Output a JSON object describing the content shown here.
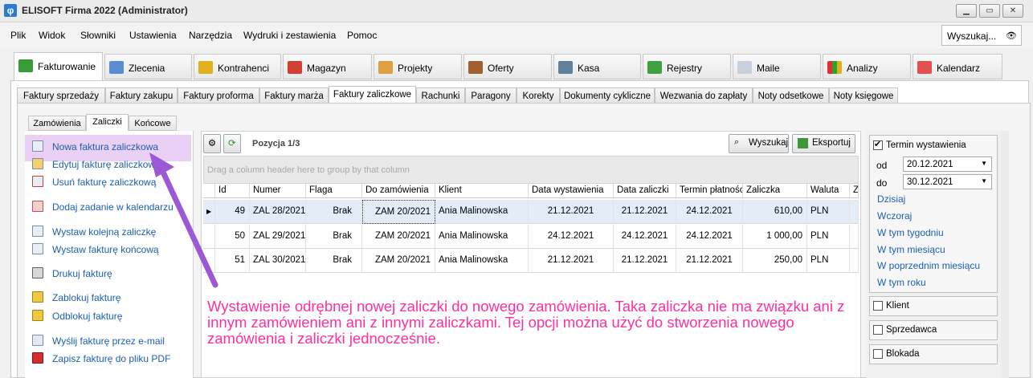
{
  "window": {
    "title": "ELISOFT Firma 2022 (Administrator)",
    "app_icon": "φ"
  },
  "menu": [
    "Plik",
    "Widok",
    "Słowniki",
    "Ustawienia",
    "Narzędzia",
    "Wydruki i zestawienia",
    "Pomoc"
  ],
  "search": {
    "label": "Wyszukaj..."
  },
  "main_tabs": [
    {
      "label": "Fakturowanie",
      "icon": "euro-icon",
      "active": true
    },
    {
      "label": "Zlecenia",
      "icon": "documents-icon"
    },
    {
      "label": "Kontrahenci",
      "icon": "people-icon"
    },
    {
      "label": "Magazyn",
      "icon": "bag-icon"
    },
    {
      "label": "Projekty",
      "icon": "pencil-ruler-icon"
    },
    {
      "label": "Oferty",
      "icon": "briefcase-icon"
    },
    {
      "label": "Kasa",
      "icon": "register-icon"
    },
    {
      "label": "Rejestry",
      "icon": "ledger-icon"
    },
    {
      "label": "Maile",
      "icon": "mail-icon"
    },
    {
      "label": "Analizy",
      "icon": "bar-chart-icon"
    },
    {
      "label": "Kalendarz",
      "icon": "calendar-icon"
    }
  ],
  "sub_tabs": [
    "Faktury sprzedaży",
    "Faktury zakupu",
    "Faktury proforma",
    "Faktury marża",
    "Faktury zaliczkowe",
    "Rachunki",
    "Paragony",
    "Korekty",
    "Dokumenty cykliczne",
    "Wezwania do zapłaty",
    "Noty odsetkowe",
    "Noty księgowe"
  ],
  "subsub_tabs": [
    "Zamówienia",
    "Zaliczki",
    "Końcowe"
  ],
  "actions": [
    {
      "label": "Nowa faktura zaliczkowa",
      "icon": "new-doc-icon"
    },
    {
      "label": "Edytuj fakturę zaliczkową",
      "icon": "edit-pencil-icon"
    },
    {
      "label": "Usuń fakturę zaliczkową",
      "icon": "delete-doc-icon"
    },
    {
      "label": "Dodaj zadanie w kalendarzu",
      "icon": "calendar-icon"
    },
    {
      "label": "Wystaw kolejną zaliczkę",
      "icon": "new-doc-icon"
    },
    {
      "label": "Wystaw fakturę końcową",
      "icon": "new-doc-icon"
    },
    {
      "label": "Drukuj fakturę",
      "icon": "printer-icon"
    },
    {
      "label": "Zablokuj fakturę",
      "icon": "lock-icon"
    },
    {
      "label": "Odblokuj fakturę",
      "icon": "unlock-icon"
    },
    {
      "label": "Wyślij fakturę przez e-mail",
      "icon": "email-icon"
    },
    {
      "label": "Zapisz fakturę do pliku PDF",
      "icon": "pdf-icon"
    }
  ],
  "toolbar": {
    "position": "Pozycja 1/3",
    "search_btn": "Wyszukaj",
    "export_btn": "Eksportuj"
  },
  "grid": {
    "group_hint": "Drag a column header here to group by that column",
    "columns": [
      "Id",
      "Numer",
      "Flaga",
      "Do zamówienia",
      "Klient",
      "Data wystawienia",
      "Data zaliczki",
      "Termin płatności",
      "Zaliczka",
      "Waluta",
      "Z"
    ],
    "rows": [
      [
        "49",
        "ZAL 28/2021",
        "Brak",
        "ZAM 20/2021",
        "Ania Malinowska",
        "21.12.2021",
        "21.12.2021",
        "24.12.2021",
        "610,00",
        "PLN",
        ""
      ],
      [
        "50",
        "ZAL 29/2021",
        "Brak",
        "ZAM 20/2021",
        "Ania Malinowska",
        "24.12.2021",
        "24.12.2021",
        "24.12.2021",
        "1 000,00",
        "PLN",
        ""
      ],
      [
        "51",
        "ZAL 30/2021",
        "Brak",
        "ZAM 20/2021",
        "Ania Malinowska",
        "21.12.2021",
        "21.12.2021",
        "21.12.2021",
        "250,00",
        "PLN",
        ""
      ]
    ]
  },
  "filters": {
    "termin": {
      "label": "Termin wystawienia",
      "checked": true,
      "od_label": "od",
      "od_value": "20.12.2021",
      "do_label": "do",
      "do_value": "30.12.2021"
    },
    "quick_links": [
      "Dzisiaj",
      "Wczoraj",
      "W tym tygodniu",
      "W tym miesiącu",
      "W poprzednim miesiącu",
      "W tym roku"
    ],
    "klient": "Klient",
    "sprzedawca": "Sprzedawca",
    "blokada": "Blokada"
  },
  "annotation": "Wystawienie odrębnej nowej zaliczki do nowego zamówienia. Taka zaliczka nie ma związku ani z innym zamówieniem ani z innymi zaliczkami. Tej opcji można użyć do stworzenia nowego zamówienia i zaliczki jednocześnie.",
  "colors": {
    "link": "#1b5fb3",
    "annotation": "#ff2fa0",
    "arrow": "#9b59d6",
    "highlight": "#ebd0f5"
  }
}
